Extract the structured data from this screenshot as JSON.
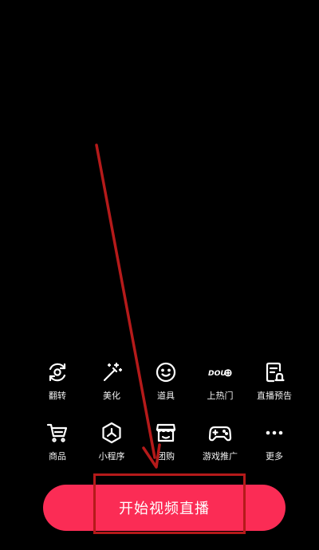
{
  "tools": [
    {
      "label": "翻转",
      "icon": "flip-camera-icon"
    },
    {
      "label": "美化",
      "icon": "beautify-wand-icon"
    },
    {
      "label": "道具",
      "icon": "smiley-props-icon"
    },
    {
      "label": "上热门",
      "icon": "dou-plus-icon",
      "icon_text": "DOU"
    },
    {
      "label": "直播预告",
      "icon": "live-preview-icon"
    },
    {
      "label": "商品",
      "icon": "shopping-cart-icon"
    },
    {
      "label": "小程序",
      "icon": "mini-program-icon"
    },
    {
      "label": "团购",
      "icon": "group-buy-store-icon"
    },
    {
      "label": "游戏推广",
      "icon": "gamepad-icon"
    },
    {
      "label": "更多",
      "icon": "more-dots-icon"
    }
  ],
  "start_button": {
    "label": "开始视频直播"
  },
  "colors": {
    "background": "#000000",
    "button": "#fb2c55",
    "annotation": "#b51a1a"
  }
}
